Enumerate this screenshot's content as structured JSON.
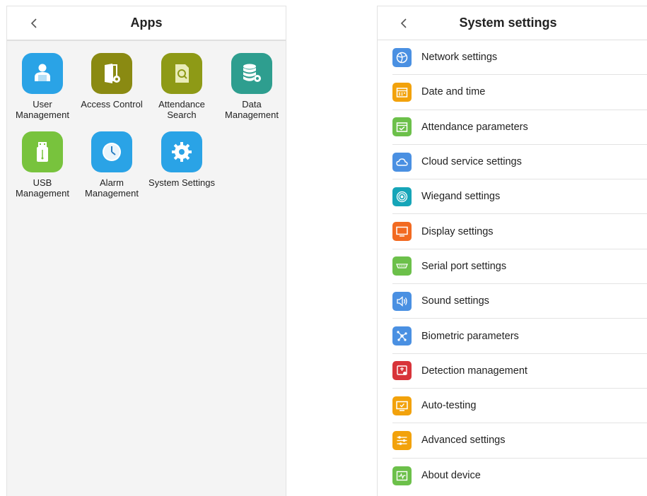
{
  "apps_panel": {
    "title": "Apps",
    "back_icon": "chevron-left-icon",
    "apps": [
      {
        "label": "User\nManagement",
        "icon": "user-icon",
        "color": "#2aa3e6"
      },
      {
        "label": "Access Control",
        "icon": "door-gear-icon",
        "color": "#8a8a12"
      },
      {
        "label": "Attendance\nSearch",
        "icon": "document-search-icon",
        "color": "#8e9a16"
      },
      {
        "label": "Data\nManagement",
        "icon": "database-gear-icon",
        "color": "#2e9e8f"
      },
      {
        "label": "USB\nManagement",
        "icon": "usb-icon",
        "color": "#78c33d"
      },
      {
        "label": "Alarm\nManagement",
        "icon": "clock-icon",
        "color": "#2aa3e6"
      },
      {
        "label": "System Settings",
        "icon": "gear-icon",
        "color": "#2aa3e6"
      }
    ]
  },
  "settings_panel": {
    "title": "System settings",
    "back_icon": "chevron-left-icon",
    "items": [
      {
        "label": "Network settings",
        "icon": "globe-icon",
        "color": "#4a90e2"
      },
      {
        "label": "Date and time",
        "icon": "calendar-icon",
        "color": "#f2a20c"
      },
      {
        "label": "Attendance parameters",
        "icon": "calendar-check-icon",
        "color": "#6cc04a"
      },
      {
        "label": "Cloud service settings",
        "icon": "cloud-icon",
        "color": "#4a90e2"
      },
      {
        "label": "Wiegand settings",
        "icon": "target-icon",
        "color": "#16a5b8"
      },
      {
        "label": "Display settings",
        "icon": "monitor-icon",
        "color": "#f26a21"
      },
      {
        "label": "Serial port settings",
        "icon": "serial-port-icon",
        "color": "#6cc04a"
      },
      {
        "label": "Sound settings",
        "icon": "speaker-icon",
        "color": "#4a90e2"
      },
      {
        "label": "Biometric parameters",
        "icon": "biometric-nodes-icon",
        "color": "#4a90e2"
      },
      {
        "label": "Detection management",
        "icon": "shield-detection-icon",
        "color": "#d8343a"
      },
      {
        "label": "Auto-testing",
        "icon": "monitor-check-icon",
        "color": "#f2a20c"
      },
      {
        "label": "Advanced settings",
        "icon": "sliders-icon",
        "color": "#f2a20c"
      },
      {
        "label": "About device",
        "icon": "device-info-icon",
        "color": "#6cc04a"
      }
    ]
  }
}
